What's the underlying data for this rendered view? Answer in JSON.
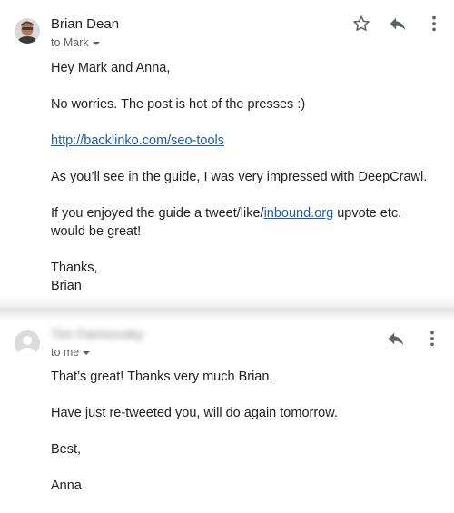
{
  "message1": {
    "sender": "Brian Dean",
    "recipient_line": "to Mark",
    "greeting": "Hey Mark and Anna,",
    "para1": "No worries. The post is hot of the presses :)",
    "link": "http://backlinko.com/seo-tools",
    "para2": "As you’ll see in the guide, I was very impressed with DeepCrawl.",
    "para3_before": "If you enjoyed the guide a tweet/like/",
    "para3_link": "inbound.org",
    "para3_after": " upvote etc. would be great!",
    "signoff": "Thanks,",
    "signature": "Brian",
    "icons": [
      "star-icon",
      "reply-icon",
      "more-vert-icon"
    ]
  },
  "message2": {
    "sender": "Tim Farmovsky",
    "recipient_line": "to me",
    "para1": "That’s great! Thanks very much Brian.",
    "para2": "Have just re-tweeted you, will do again tomorrow.",
    "signoff": "Best,",
    "signature": "Anna",
    "icons": [
      "reply-icon",
      "more-vert-icon"
    ]
  },
  "colors": {
    "link": "#1a5cb8",
    "text": "#202124",
    "muted": "#5f6368"
  }
}
